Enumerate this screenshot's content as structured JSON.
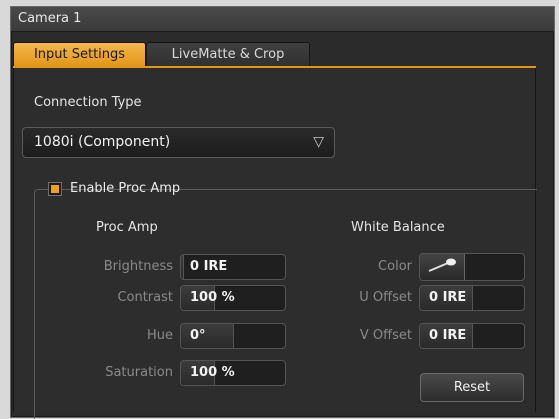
{
  "window": {
    "title": "Camera 1"
  },
  "tabs": [
    {
      "label": "Input Settings",
      "active": true
    },
    {
      "label": "LiveMatte & Crop",
      "active": false
    }
  ],
  "connection": {
    "label": "Connection Type",
    "selected": "1080i (Component)",
    "arrow": "▽"
  },
  "procamp_group": {
    "enable_label": "Enable Proc Amp",
    "enabled": true
  },
  "procamp": {
    "heading": "Proc Amp",
    "fields": [
      {
        "label": "Brightness",
        "value": "0 IRE",
        "fill": 0.02
      },
      {
        "label": "Contrast",
        "value": "100 %",
        "fill": 0.32
      },
      {
        "label": "Hue",
        "value": "0°",
        "fill": 0.5
      },
      {
        "label": "Saturation",
        "value": "100 %",
        "fill": 0.32
      }
    ]
  },
  "white_balance": {
    "heading": "White Balance",
    "color_label": "Color",
    "color_icon": "eyedropper-icon",
    "fields": [
      {
        "label": "U Offset",
        "value": "0 IRE",
        "fill": 0.5
      },
      {
        "label": "V Offset",
        "value": "0 IRE",
        "fill": 0.5
      }
    ],
    "reset_label": "Reset"
  },
  "colors": {
    "accent": "#e29619",
    "panel": "#2d2d2d",
    "text": "#e6e6e6",
    "dim_text": "#8a8a8a"
  }
}
